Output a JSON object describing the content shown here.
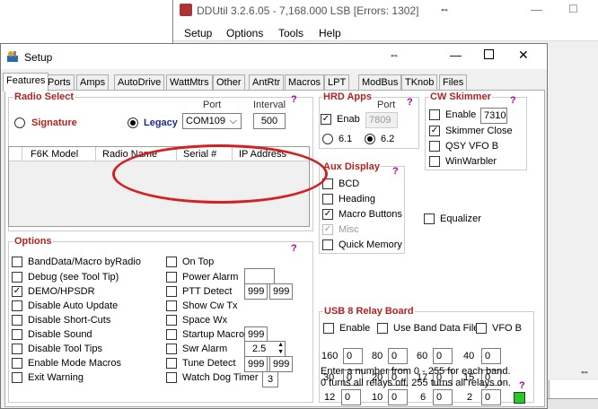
{
  "background_window": {
    "title": "DDUtil 3.2.6.05 - 7,168.000  LSB [Errors: 1302]",
    "move_glyph": "⇔",
    "menu": [
      "Setup",
      "Options",
      "Tools",
      "Help"
    ]
  },
  "setup_window": {
    "title": "Setup",
    "move_glyph": "⇔",
    "close_glyph": "✕",
    "min_glyph": "—"
  },
  "tabs": [
    "Features",
    "Ports",
    "Amps",
    "AutoDrive",
    "WattMtrs",
    "Other",
    "AntRtr",
    "Macros",
    "LPT",
    "ModBus",
    "TKnob",
    "Files"
  ],
  "radio_select": {
    "title": "Radio Select",
    "signature": "Signature",
    "legacy": "Legacy",
    "port_label": "Port",
    "port_value": "COM109",
    "interval_label": "Interval",
    "interval_value": "500",
    "help": "?",
    "columns": [
      "F6K Model",
      "Radio Name",
      "Serial #",
      "IP Address"
    ]
  },
  "hrd_apps": {
    "title": "HRD Apps",
    "port_label": "Port",
    "enab": "Enab",
    "port_value": "7809",
    "v61": "6.1",
    "v62": "6.2",
    "help": "?"
  },
  "cw_skimmer": {
    "title": "CW Skimmer",
    "help": "?",
    "enable": "Enable",
    "enable_value": "7310",
    "skimmer_close": "Skimmer Close",
    "qsy": "QSY VFO B",
    "winwarbler": "WinWarbler"
  },
  "aux_display": {
    "title": "Aux Display",
    "help": "?",
    "items": [
      "BCD",
      "Heading",
      "Macro Buttons",
      "Misc",
      "Quick Memory"
    ]
  },
  "equalizer": "Equalizer",
  "options": {
    "title": "Options",
    "help": "?",
    "col1": [
      "BandData/Macro byRadio",
      "Debug (see Tool Tip)",
      "DEMO/HPSDR",
      "Disable Auto Update",
      "Disable Short-Cuts",
      "Disable Sound",
      "Disable Tool Tips",
      "Enable Mode Macros",
      "Exit Warning"
    ],
    "col2": [
      "On Top",
      "Power Alarm",
      "PTT Detect",
      "Show Cw Tx",
      "Space Wx",
      "Startup Macro",
      "Swr Alarm",
      "Tune Detect",
      "Watch Dog Timer"
    ],
    "ptt_a": "999",
    "ptt_b": "999",
    "startup_value": "999",
    "swr_value": "2.5",
    "tune_a": "999",
    "tune_b": "999",
    "watchdog_value": "3"
  },
  "relay_board": {
    "title": "USB 8 Relay Board",
    "enable": "Enable",
    "use_band": "Use Band Data File",
    "vfob": "VFO B",
    "bands": [
      [
        "160",
        "0"
      ],
      [
        "80",
        "0"
      ],
      [
        "60",
        "0"
      ],
      [
        "40",
        "0"
      ],
      [
        "30",
        "0"
      ],
      [
        "20",
        "0"
      ],
      [
        "17",
        "0"
      ],
      [
        "15",
        "0"
      ],
      [
        "12",
        "0"
      ],
      [
        "10",
        "0"
      ],
      [
        "6",
        "0"
      ],
      [
        "2",
        "0"
      ]
    ],
    "note1": "Enter a number from 0 - 255 for each band.",
    "note2": "0 turns all relays off, 255 turns all relays on.",
    "help": "?",
    "status_color": "#22cc22"
  }
}
